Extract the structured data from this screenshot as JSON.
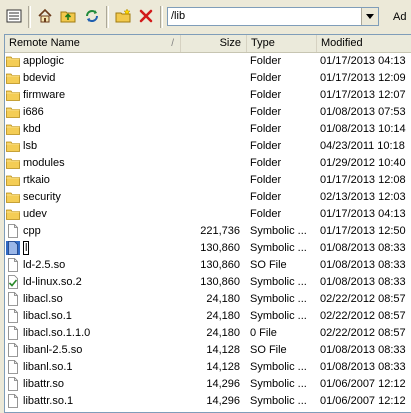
{
  "toolbar": {
    "path_value": "/lib",
    "address_label": "Ad",
    "buttons": [
      {
        "name": "parent-directory-icon"
      },
      {
        "name": "home-icon"
      },
      {
        "name": "up-folder-icon"
      },
      {
        "name": "refresh-icon"
      },
      {
        "name": "new-folder-icon"
      },
      {
        "name": "delete-icon"
      }
    ]
  },
  "columns": {
    "name": "Remote Name",
    "size": "Size",
    "type": "Type",
    "modified": "Modified",
    "sort_indicator": "/"
  },
  "files": [
    {
      "icon": "folder-icon",
      "name": "applogic",
      "size": "",
      "type": "Folder",
      "modified": "01/17/2013 04:13"
    },
    {
      "icon": "folder-icon",
      "name": "bdevid",
      "size": "",
      "type": "Folder",
      "modified": "01/17/2013 12:09"
    },
    {
      "icon": "folder-icon",
      "name": "firmware",
      "size": "",
      "type": "Folder",
      "modified": "01/17/2013 12:07"
    },
    {
      "icon": "folder-icon",
      "name": "i686",
      "size": "",
      "type": "Folder",
      "modified": "01/08/2013 07:53"
    },
    {
      "icon": "folder-icon",
      "name": "kbd",
      "size": "",
      "type": "Folder",
      "modified": "01/08/2013 10:14"
    },
    {
      "icon": "folder-icon",
      "name": "lsb",
      "size": "",
      "type": "Folder",
      "modified": "04/23/2011 10:18"
    },
    {
      "icon": "folder-icon",
      "name": "modules",
      "size": "",
      "type": "Folder",
      "modified": "01/29/2012 10:40"
    },
    {
      "icon": "folder-icon",
      "name": "rtkaio",
      "size": "",
      "type": "Folder",
      "modified": "01/17/2013 12:08"
    },
    {
      "icon": "folder-icon",
      "name": "security",
      "size": "",
      "type": "Folder",
      "modified": "02/13/2013 12:03"
    },
    {
      "icon": "folder-icon",
      "name": "udev",
      "size": "",
      "type": "Folder",
      "modified": "01/17/2013 04:13"
    },
    {
      "icon": "file-icon",
      "name": "cpp",
      "size": "221,736",
      "type": "Symbolic ...",
      "modified": "01/17/2013 12:50"
    },
    {
      "icon": "file-icon-selected",
      "name": "l",
      "size": "130,860",
      "type": "Symbolic ...",
      "modified": "01/08/2013 08:33",
      "editing": true
    },
    {
      "icon": "file-icon",
      "name": "ld-2.5.so",
      "size": "130,860",
      "type": "SO File",
      "modified": "01/08/2013 08:33"
    },
    {
      "icon": "checked-file-icon",
      "name": "ld-linux.so.2",
      "size": "130,860",
      "type": "Symbolic ...",
      "modified": "01/08/2013 08:33"
    },
    {
      "icon": "file-icon",
      "name": "libacl.so",
      "size": "24,180",
      "type": "Symbolic ...",
      "modified": "02/22/2012 08:57"
    },
    {
      "icon": "file-icon",
      "name": "libacl.so.1",
      "size": "24,180",
      "type": "Symbolic ...",
      "modified": "02/22/2012 08:57"
    },
    {
      "icon": "file-icon",
      "name": "libacl.so.1.1.0",
      "size": "24,180",
      "type": "0 File",
      "modified": "02/22/2012 08:57"
    },
    {
      "icon": "file-icon",
      "name": "libanl-2.5.so",
      "size": "14,128",
      "type": "SO File",
      "modified": "01/08/2013 08:33"
    },
    {
      "icon": "file-icon",
      "name": "libanl.so.1",
      "size": "14,128",
      "type": "Symbolic ...",
      "modified": "01/08/2013 08:33"
    },
    {
      "icon": "file-icon",
      "name": "libattr.so",
      "size": "14,296",
      "type": "Symbolic ...",
      "modified": "01/06/2007 12:12"
    },
    {
      "icon": "file-icon",
      "name": "libattr.so.1",
      "size": "14,296",
      "type": "Symbolic ...",
      "modified": "01/06/2007 12:12"
    }
  ]
}
